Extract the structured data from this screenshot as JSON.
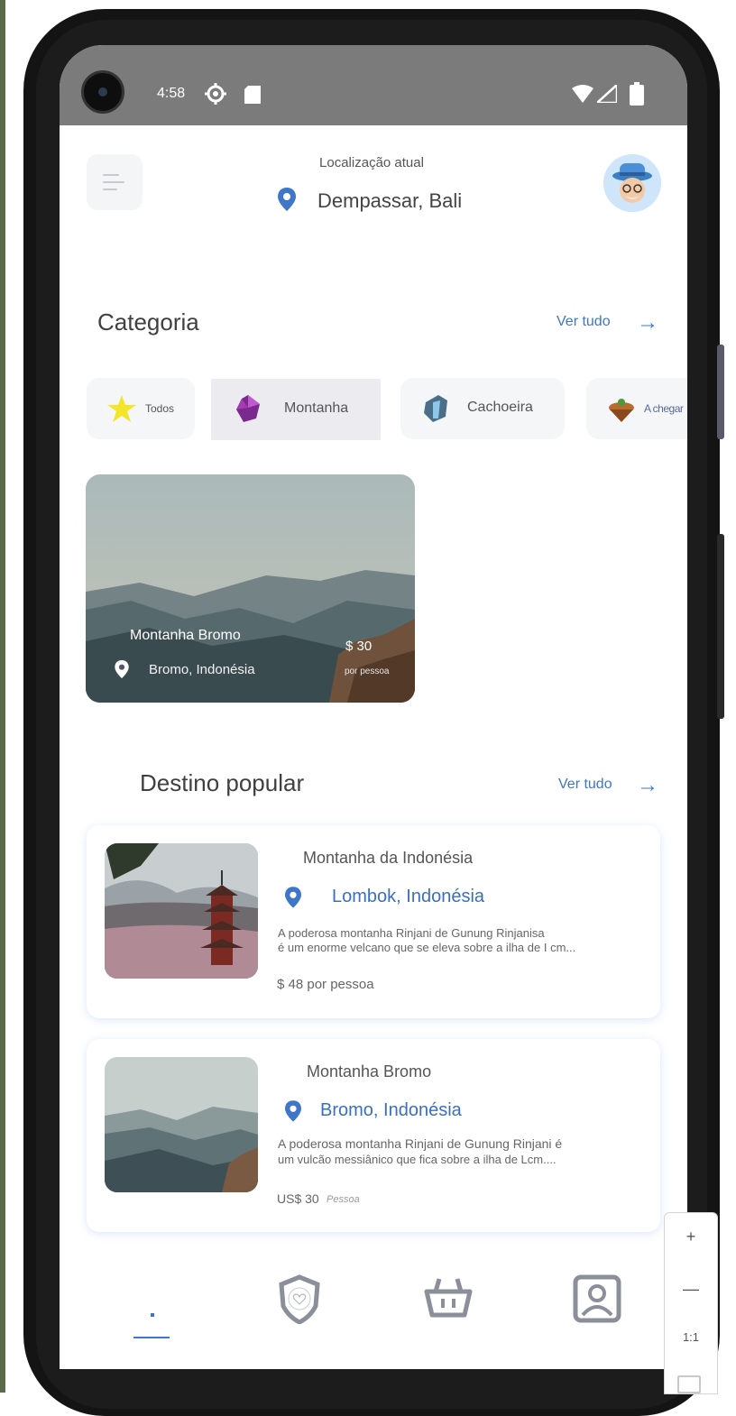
{
  "status_bar": {
    "time": "4:58"
  },
  "header": {
    "location_label": "Localização atual",
    "location_city": "Dempassar, Bali"
  },
  "categories_section": {
    "title": "Categoria",
    "see_all": "Ver tudo",
    "items": [
      {
        "label": "Todos",
        "icon": "star-icon"
      },
      {
        "label": "Montanha",
        "icon": "mountain-gem-icon"
      },
      {
        "label": "Cachoeira",
        "icon": "waterfall-rock-icon"
      },
      {
        "label": "A chegar",
        "icon": "island-icon"
      }
    ],
    "selected": "Montanha"
  },
  "featured": {
    "title": "Montanha Bromo",
    "location": "Bromo, Indonésia",
    "price": "$ 30",
    "per_person": "por pessoa"
  },
  "popular_section": {
    "title": "Destino popular",
    "see_all": "Ver tudo",
    "items": [
      {
        "title": "Montanha da Indonésia",
        "location": "Lombok, Indonésia",
        "desc_line1": "A poderosa montanha Rinjani de Gunung Rinjanisa",
        "desc_line2": "é um enorme velcano que se eleva sobre a ilha de I cm...",
        "price": "$ 48 por pessoa"
      },
      {
        "title": "Montanha Bromo",
        "location": "Bromo, Indonésia",
        "desc_line1": "A poderosa montanha Rinjani de Gunung Rinjani é",
        "desc_line2": "um vulcão messiânico que fica sobre a ilha de Lcm....",
        "price": "US$ 30",
        "price_suffix": "Pessoa"
      }
    ]
  },
  "bottom_nav": [
    "home-icon",
    "favorites-shield-icon",
    "basket-icon",
    "profile-icon"
  ],
  "zoom_widget": {
    "plus": "+",
    "minus": "—",
    "ratio": "1:1"
  },
  "colors": {
    "accent": "#3f76c8",
    "status_bar": "#7b7b7b",
    "text": "#404040"
  }
}
